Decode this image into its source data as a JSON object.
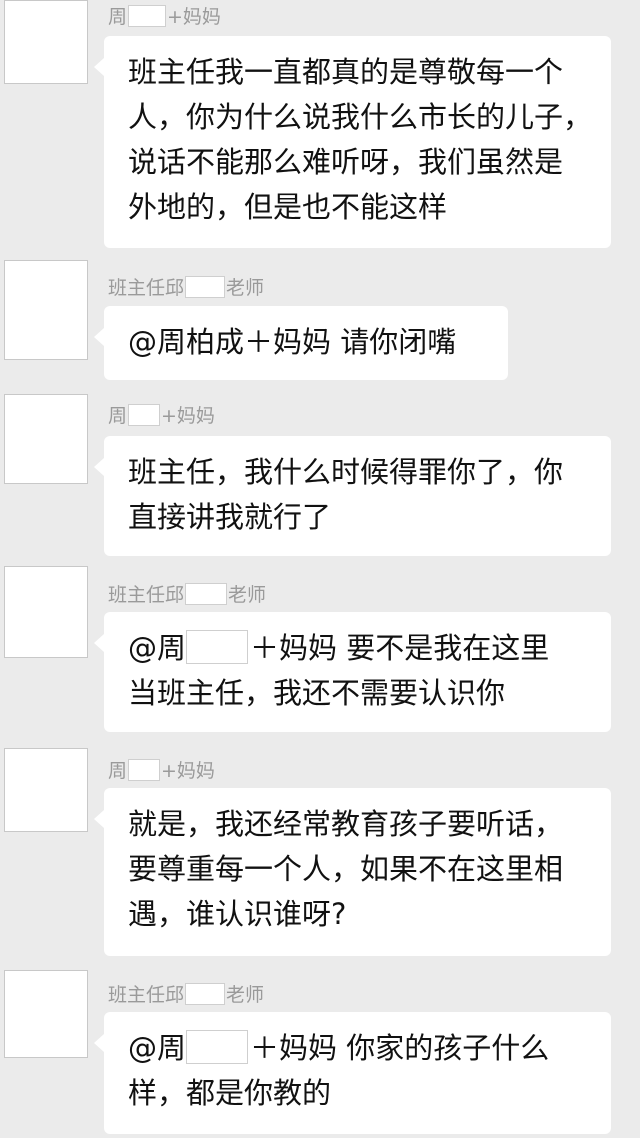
{
  "messages": [
    {
      "sender": {
        "before": "周",
        "after": "+妈妈"
      },
      "lines": [
        {
          "text": "班主任我一直都真的是尊敬每一个"
        },
        {
          "text": "人，你为什么说我什么市长的儿子，"
        },
        {
          "text": "说话不能那么难听呀，我们虽然是"
        },
        {
          "text": "外地的，但是也不能这样"
        }
      ]
    },
    {
      "sender": {
        "before": "班主任邱",
        "after": "老师"
      },
      "lines": [
        {
          "text": "@周柏成＋妈妈  请你闭嘴"
        }
      ]
    },
    {
      "sender": {
        "before": "周",
        "after": "+妈妈"
      },
      "lines": [
        {
          "text": "班主任，我什么时候得罪你了，你"
        },
        {
          "text": "直接讲我就行了"
        }
      ]
    },
    {
      "sender": {
        "before": "班主任邱",
        "after": "老师"
      },
      "lines": [
        {
          "before": "@周",
          "after": "＋妈妈  要不是我在这里"
        },
        {
          "text": "当班主任，我还不需要认识你"
        }
      ]
    },
    {
      "sender": {
        "before": "周",
        "after": "+妈妈"
      },
      "lines": [
        {
          "text": "就是，我还经常教育孩子要听话，"
        },
        {
          "text": "要尊重每一个人，如果不在这里相"
        },
        {
          "text": "遇，谁认识谁呀?"
        }
      ]
    },
    {
      "sender": {
        "before": "班主任邱",
        "after": "老师"
      },
      "lines": [
        {
          "before": "@周",
          "after": "＋妈妈  你家的孩子什么"
        },
        {
          "text": "样，都是你教的"
        }
      ]
    }
  ]
}
